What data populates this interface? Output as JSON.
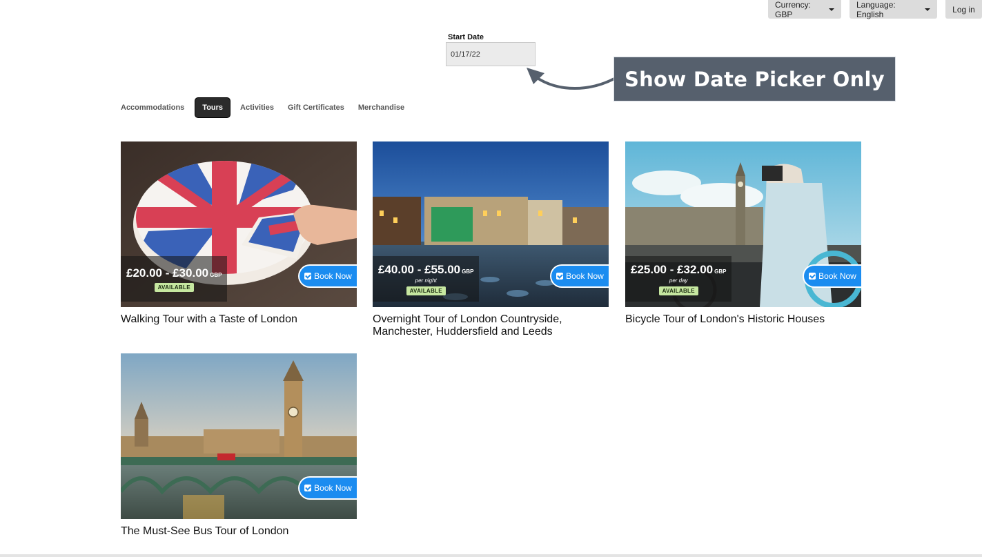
{
  "topbar": {
    "currency_label": "Currency: GBP",
    "language_label": "Language: English",
    "login_label": "Log in"
  },
  "date_filter": {
    "label": "Start Date",
    "value": "01/17/22"
  },
  "annotation": {
    "text": "Show Date Picker Only"
  },
  "tabs": [
    {
      "label": "Accommodations",
      "active": false
    },
    {
      "label": "Tours",
      "active": true
    },
    {
      "label": "Activities",
      "active": false
    },
    {
      "label": "Gift Certificates",
      "active": false
    },
    {
      "label": "Merchandise",
      "active": false
    }
  ],
  "cards": [
    {
      "title": "Walking Tour with a Taste of London",
      "price": "£20.00 - £30.00",
      "currency": "GBP",
      "per": "",
      "status": "AVAILABLE",
      "book_label": "Book Now",
      "image": "union-jack-cake"
    },
    {
      "title": "Overnight Tour of London Countryside, Manchester, Huddersfield and Leeds",
      "price": "£40.00 - £55.00",
      "currency": "GBP",
      "per": "per night",
      "status": "AVAILABLE",
      "book_label": "Book Now",
      "image": "city-square-night"
    },
    {
      "title": "Bicycle Tour of London's Historic Houses",
      "price": "£25.00 - £32.00",
      "currency": "GBP",
      "per": "per day",
      "status": "AVAILABLE",
      "book_label": "Book Now",
      "image": "woman-bicycle-big-ben"
    },
    {
      "title": "The Must-See Bus Tour of London",
      "price": "",
      "currency": "",
      "per": "",
      "status": "",
      "book_label": "Book Now",
      "image": "westminster-bridge-big-ben"
    }
  ],
  "colors": {
    "book_button": "#1b8cf0",
    "available_badge": "#c6e7a0",
    "active_tab": "#2b2b2b",
    "callout": "#56606d"
  }
}
